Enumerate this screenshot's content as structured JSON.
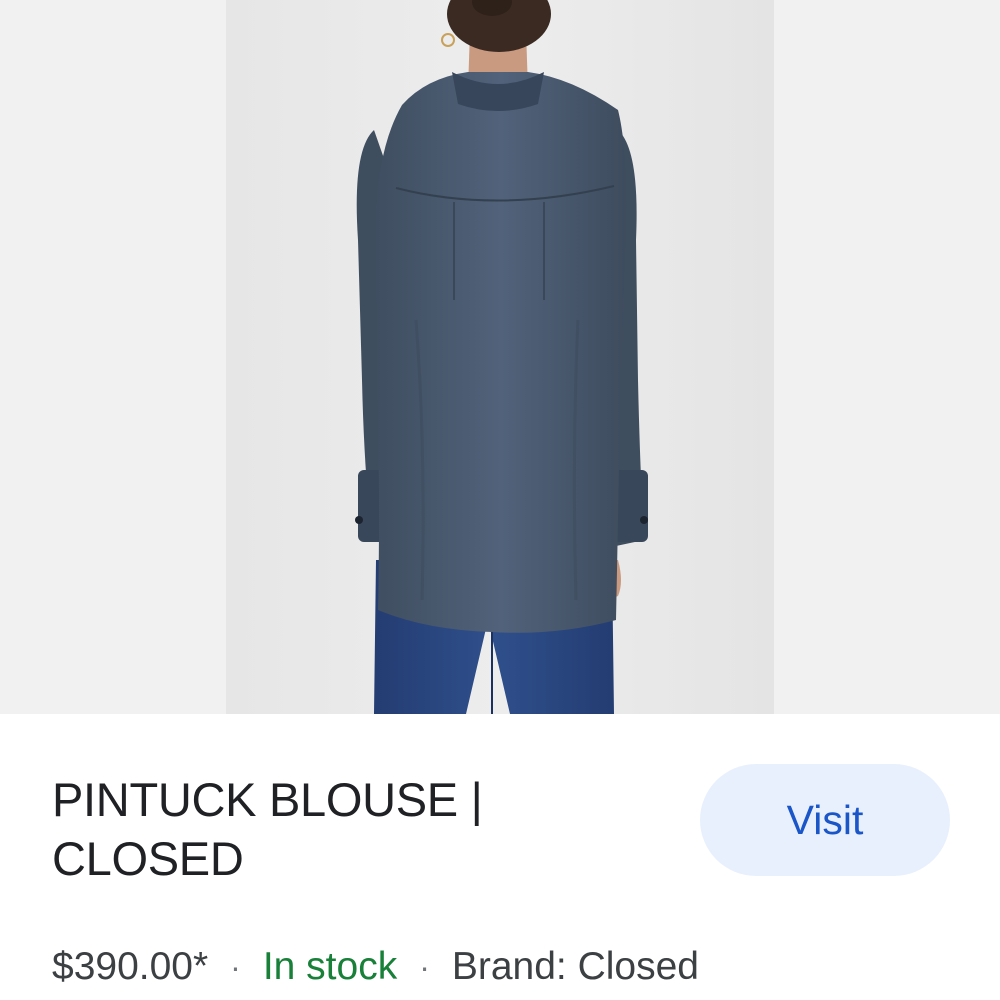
{
  "product": {
    "title_line1": "PINTUCK BLOUSE |",
    "title_line2": "CLOSED",
    "price": "$390.00*",
    "separator": "·",
    "availability": "In stock",
    "brand": "Brand: Closed",
    "visit_label": "Visit"
  },
  "colors": {
    "availability_green": "#188038",
    "visit_text_blue": "#1a56c7",
    "visit_bg": "#e8f0fe",
    "blouse_navy": "#4a5a6e",
    "jeans_blue": "#2c4a86"
  },
  "image": {
    "icon": "product-photo"
  }
}
